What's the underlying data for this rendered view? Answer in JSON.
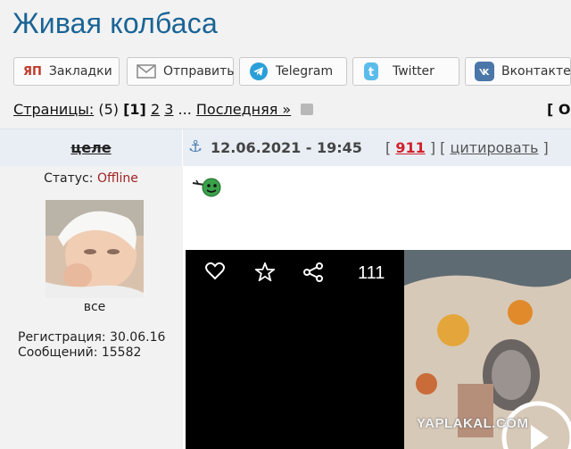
{
  "page": {
    "title": "Живая колбаса"
  },
  "share": {
    "buttons": [
      {
        "label": "Закладки",
        "icon": "yap-bookmarks-icon"
      },
      {
        "label": "Отправить",
        "icon": "envelope-icon"
      },
      {
        "label": "Telegram",
        "icon": "telegram-icon"
      },
      {
        "label": "Twitter",
        "icon": "twitter-icon"
      },
      {
        "label": "Вконтакте",
        "icon": "vk-icon"
      }
    ],
    "yap_badge": "ЯП"
  },
  "pager": {
    "label": "Страницы:",
    "count": "(5)",
    "current": "[1]",
    "pages": [
      "2",
      "3"
    ],
    "ellipsis": "...",
    "last": "Последняя »",
    "right_fragment": "[ О"
  },
  "post": {
    "author": "целе",
    "date": "12.06.2021 - 19:45",
    "rating_open": "[",
    "rating": "911",
    "rating_close": "] [",
    "quote": "цитировать",
    "quote_close": "]"
  },
  "user": {
    "status_label": "Статус:",
    "status_value": "Offline",
    "avatar_caption": "все",
    "registration": "Регистрация: 30.06.16",
    "messages": "Сообщений: 15582"
  },
  "video": {
    "count": "111",
    "watermark": "YAPLAKAL.COM"
  },
  "colors": {
    "title": "#1a6496",
    "offline": "#a12323",
    "rating": "#d1202a",
    "header_band": "#e9eef4"
  }
}
